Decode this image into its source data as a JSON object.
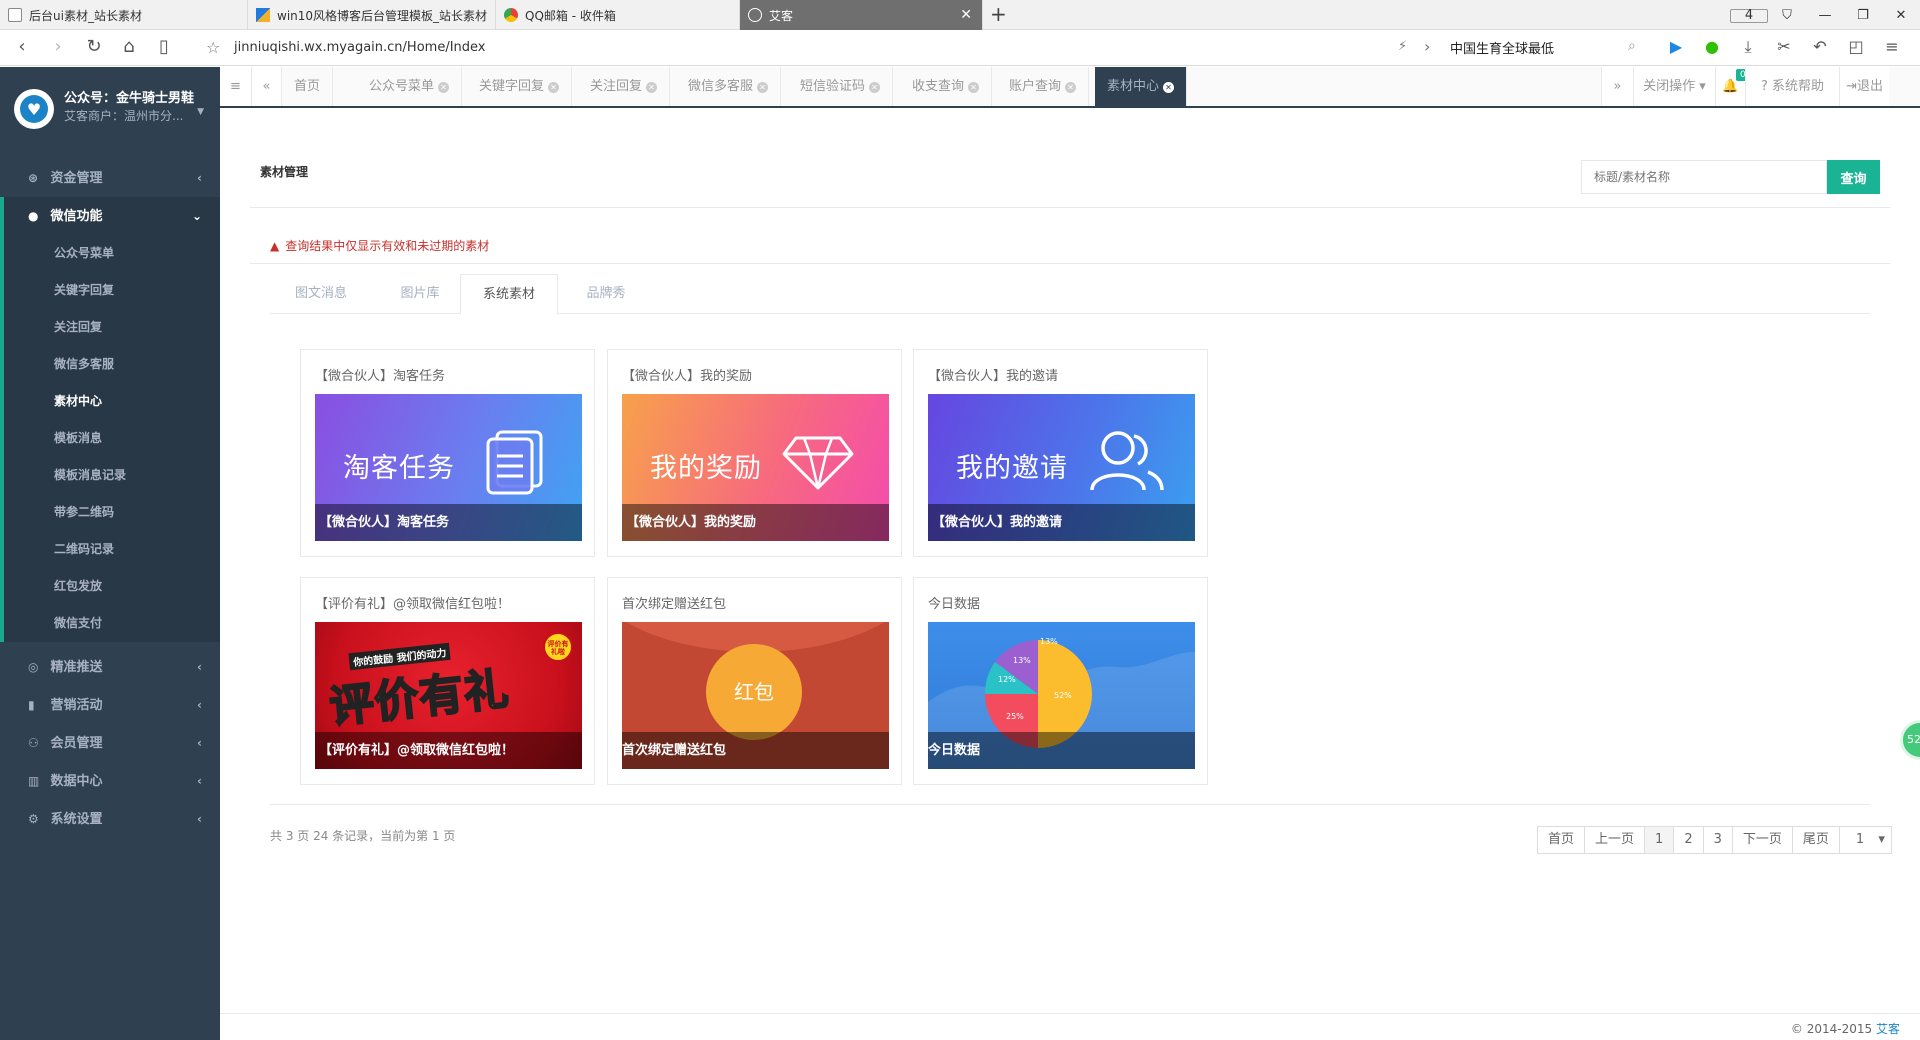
{
  "browser": {
    "tabs": [
      {
        "label": "后台ui素材_站长素材"
      },
      {
        "label": "win10风格博客后台管理模板_站长素材"
      },
      {
        "label": "QQ邮箱 - 收件箱"
      },
      {
        "label": "艾客"
      }
    ],
    "tab_count": "4",
    "url": "jinniuqishi.wx.myagain.cn/Home/Index",
    "search_text": "中国生育全球最低"
  },
  "sidebar": {
    "profile_name": "公众号：金牛骑士男鞋",
    "profile_sub": "艾客商户：温州市分...",
    "menu": [
      {
        "label": "资金管理"
      },
      {
        "label": "微信功能"
      },
      {
        "label": "精准推送"
      },
      {
        "label": "营销活动"
      },
      {
        "label": "会员管理"
      },
      {
        "label": "数据中心"
      },
      {
        "label": "系统设置"
      }
    ],
    "submenu": [
      {
        "label": "公众号菜单"
      },
      {
        "label": "关键字回复"
      },
      {
        "label": "关注回复"
      },
      {
        "label": "微信多客服"
      },
      {
        "label": "素材中心"
      },
      {
        "label": "模板消息"
      },
      {
        "label": "模板消息记录"
      },
      {
        "label": "带参二维码"
      },
      {
        "label": "二维码记录"
      },
      {
        "label": "红包发放"
      },
      {
        "label": "微信支付"
      }
    ]
  },
  "content_tabs": {
    "items": [
      {
        "label": "首页"
      },
      {
        "label": "公众号菜单"
      },
      {
        "label": "关键字回复"
      },
      {
        "label": "关注回复"
      },
      {
        "label": "微信多客服"
      },
      {
        "label": "短信验证码"
      },
      {
        "label": "收支查询"
      },
      {
        "label": "账户查询"
      },
      {
        "label": "素材中心"
      }
    ],
    "close_ops": "关闭操作",
    "notif_count": "0",
    "help": "系统帮助",
    "logout": "退出"
  },
  "main": {
    "title": "素材管理",
    "search_placeholder": "标题/素材名称",
    "search_btn": "查询",
    "alert": "查询结果中仅显示有效和未过期的素材",
    "tabs": [
      {
        "label": "图文消息"
      },
      {
        "label": "图片库"
      },
      {
        "label": "系统素材"
      },
      {
        "label": "品牌秀"
      }
    ],
    "cards": [
      {
        "title": "【微合伙人】淘客任务",
        "image_text": "淘客任务",
        "caption": "【微合伙人】淘客任务"
      },
      {
        "title": "【微合伙人】我的奖励",
        "image_text": "我的奖励",
        "caption": "【微合伙人】我的奖励"
      },
      {
        "title": "【微合伙人】我的邀请",
        "image_text": "我的邀请",
        "caption": "【微合伙人】我的邀请"
      },
      {
        "title": "【评价有礼】@领取微信红包啦！",
        "image_text": "评价有礼",
        "image_sub": "你的鼓励 我们的动力",
        "image_badge": "评价有礼啦",
        "caption": "【评价有礼】@领取微信红包啦！"
      },
      {
        "title": "首次绑定赠送红包",
        "image_text": "红包",
        "caption": "首次绑定赠送红包"
      },
      {
        "title": "今日数据",
        "caption": "今日数据",
        "pie_labels": [
          "13%",
          "12%",
          "25%",
          "52%"
        ]
      }
    ],
    "pagination": {
      "info": "共 3 页 24 条记录，当前为第 1 页",
      "first": "首页",
      "prev": "上一页",
      "pages": [
        "1",
        "2",
        "3"
      ],
      "next": "下一页",
      "last": "尾页",
      "select": "1"
    }
  },
  "footer": {
    "copyright": "© 2014-2015",
    "brand": "艾客"
  },
  "float_bubble": "52",
  "colors": {
    "sidebar_bg": "#2f4050",
    "accent": "#1ab394",
    "alert": "#c9302c"
  }
}
